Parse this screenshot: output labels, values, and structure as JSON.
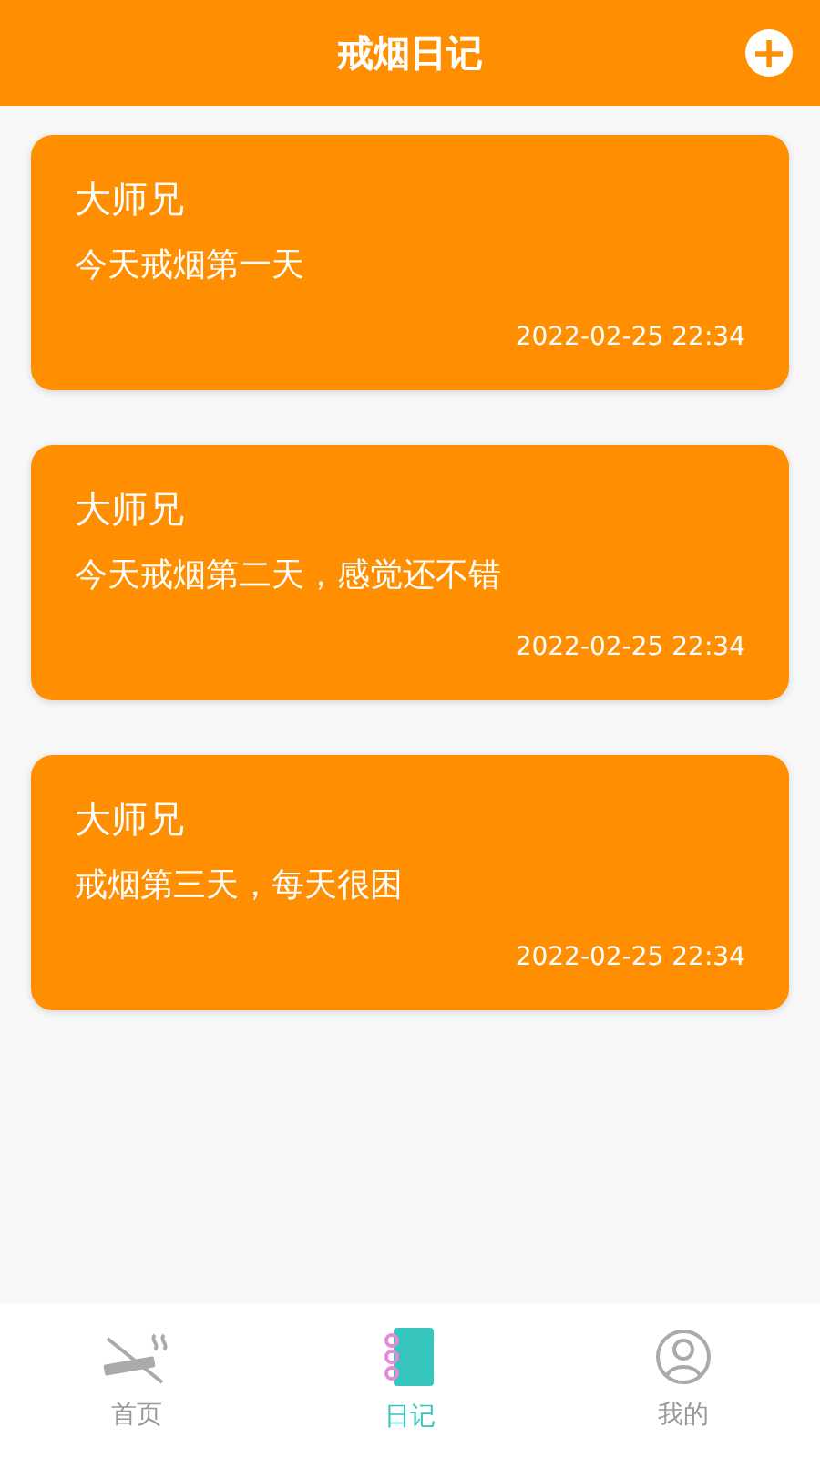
{
  "header": {
    "title": "戒烟日记",
    "add_button": "+"
  },
  "entries": [
    {
      "author": "大师兄",
      "text": "今天戒烟第一天",
      "time": "2022-02-25 22:34"
    },
    {
      "author": "大师兄",
      "text": "今天戒烟第二天，感觉还不错",
      "time": "2022-02-25 22:34"
    },
    {
      "author": "大师兄",
      "text": "戒烟第三天，每天很困",
      "time": "2022-02-25 22:34"
    }
  ],
  "tabs": [
    {
      "label": "首页",
      "kind": "home",
      "selected": false
    },
    {
      "label": "日记",
      "kind": "diary",
      "selected": true
    },
    {
      "label": "我的",
      "kind": "me",
      "selected": false
    }
  ]
}
